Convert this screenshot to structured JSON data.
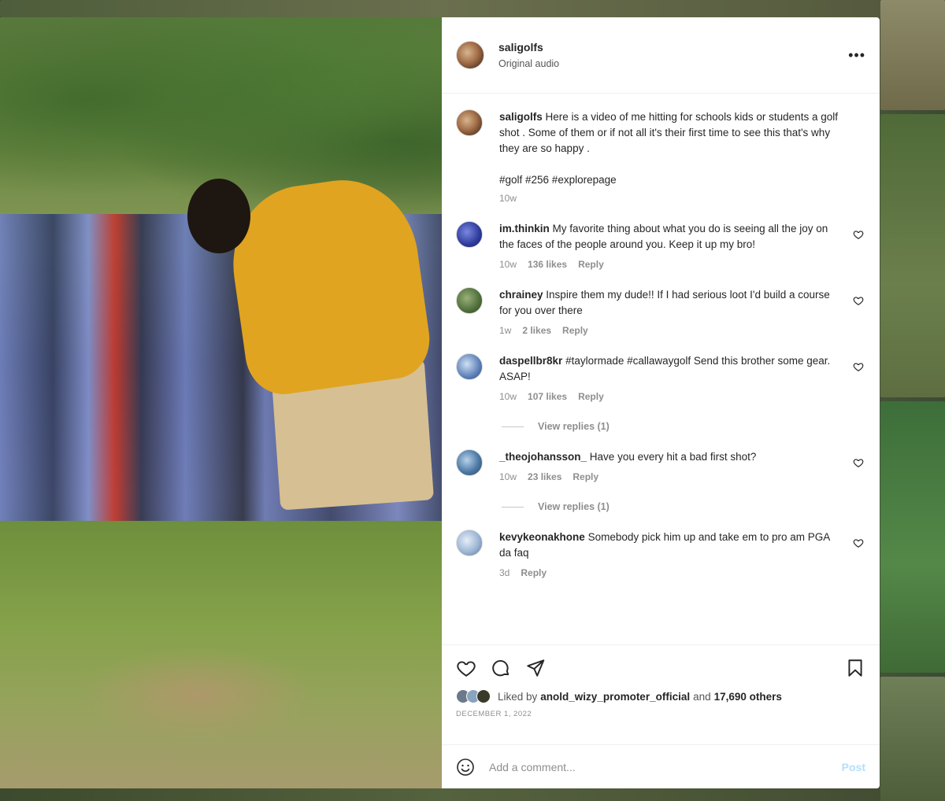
{
  "post": {
    "username": "saligolfs",
    "audio_label": "Original audio",
    "more_label": "•••",
    "caption": {
      "username": "saligolfs",
      "text": "Here is a video of me hitting for schools kids or students a golf shot . Some of them or if not all it's their first time to see this that's why they are so happy .",
      "hashtags": "#golf #256 #explorepage",
      "age": "10w"
    }
  },
  "comments": [
    {
      "username": "im.thinkin",
      "text": "My favorite thing about what you do is seeing all the joy on the faces of the people around you. Keep it up my bro!",
      "age": "10w",
      "likes": "136 likes",
      "reply": "Reply",
      "avatar_color": "blue"
    },
    {
      "username": "chrainey",
      "text": "Inspire them my dude!! If I had serious loot I'd build a course for you over there",
      "age": "1w",
      "likes": "2 likes",
      "reply": "Reply",
      "avatar_color": "green"
    },
    {
      "username": "daspellbr8kr",
      "text": "#taylormade #callawaygolf Send this brother some gear. ASAP!",
      "age": "10w",
      "likes": "107 likes",
      "reply": "Reply",
      "view_replies": "View replies (1)",
      "avatar_color": "sky"
    },
    {
      "username": "_theojohansson_",
      "text": "Have you every hit a bad first shot?",
      "age": "10w",
      "likes": "23 likes",
      "reply": "Reply",
      "view_replies": "View replies (1)",
      "avatar_color": "sea"
    },
    {
      "username": "kevykeonakhone",
      "text": "Somebody pick him up and take em to pro am PGA da faq",
      "age": "3d",
      "reply": "Reply",
      "avatar_color": "pale"
    }
  ],
  "actions": {
    "icons": [
      "heart-icon",
      "comment-icon",
      "share-icon",
      "bookmark-icon"
    ],
    "liked_by_prefix": "Liked by",
    "liked_by_user": "anold_wizy_promoter_official",
    "liked_by_and": "and",
    "liked_by_others": "17,690 others",
    "date": "DECEMBER 1, 2022"
  },
  "add_comment": {
    "placeholder": "Add a comment...",
    "post_label": "Post"
  }
}
